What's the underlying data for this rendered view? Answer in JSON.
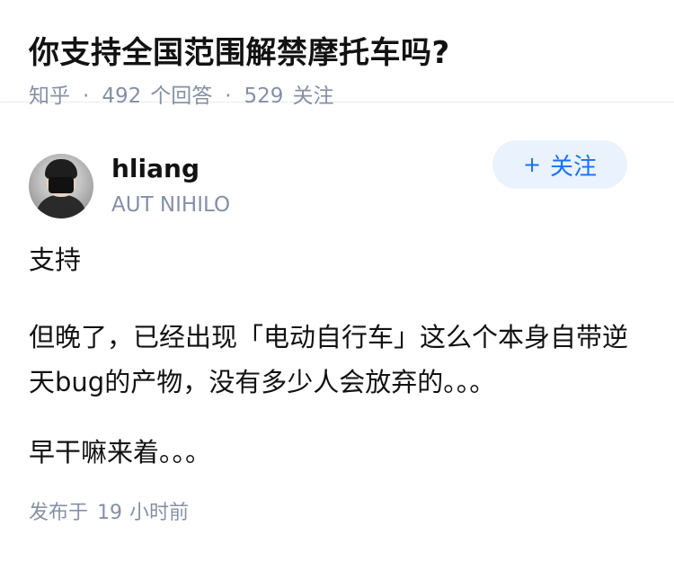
{
  "question": {
    "title": "你支持全国范围解禁摩托车吗?",
    "source": "知乎",
    "answer_count": "492",
    "answer_label": "个回答",
    "follower_count": "529",
    "follower_label": "关注"
  },
  "answer": {
    "author_name": "hliang",
    "author_bio": "AUT NIHILO",
    "follow_plus": "+",
    "follow_label": "关注",
    "paragraphs": [
      "支持",
      "但晚了，已经出现「电动自行车」这么个本身自带逆天bug的产物，没有多少人会放弃的。。。",
      "早干嘛来着。。。"
    ],
    "published_prefix": "发布于",
    "published_num": "19",
    "published_suffix": "小时前"
  },
  "colors": {
    "meta_gray": "#8590a6",
    "accent_blue": "#1772f6",
    "follow_bg": "#eaf3fd"
  },
  "icons": {
    "avatar": "avatar-photo"
  }
}
